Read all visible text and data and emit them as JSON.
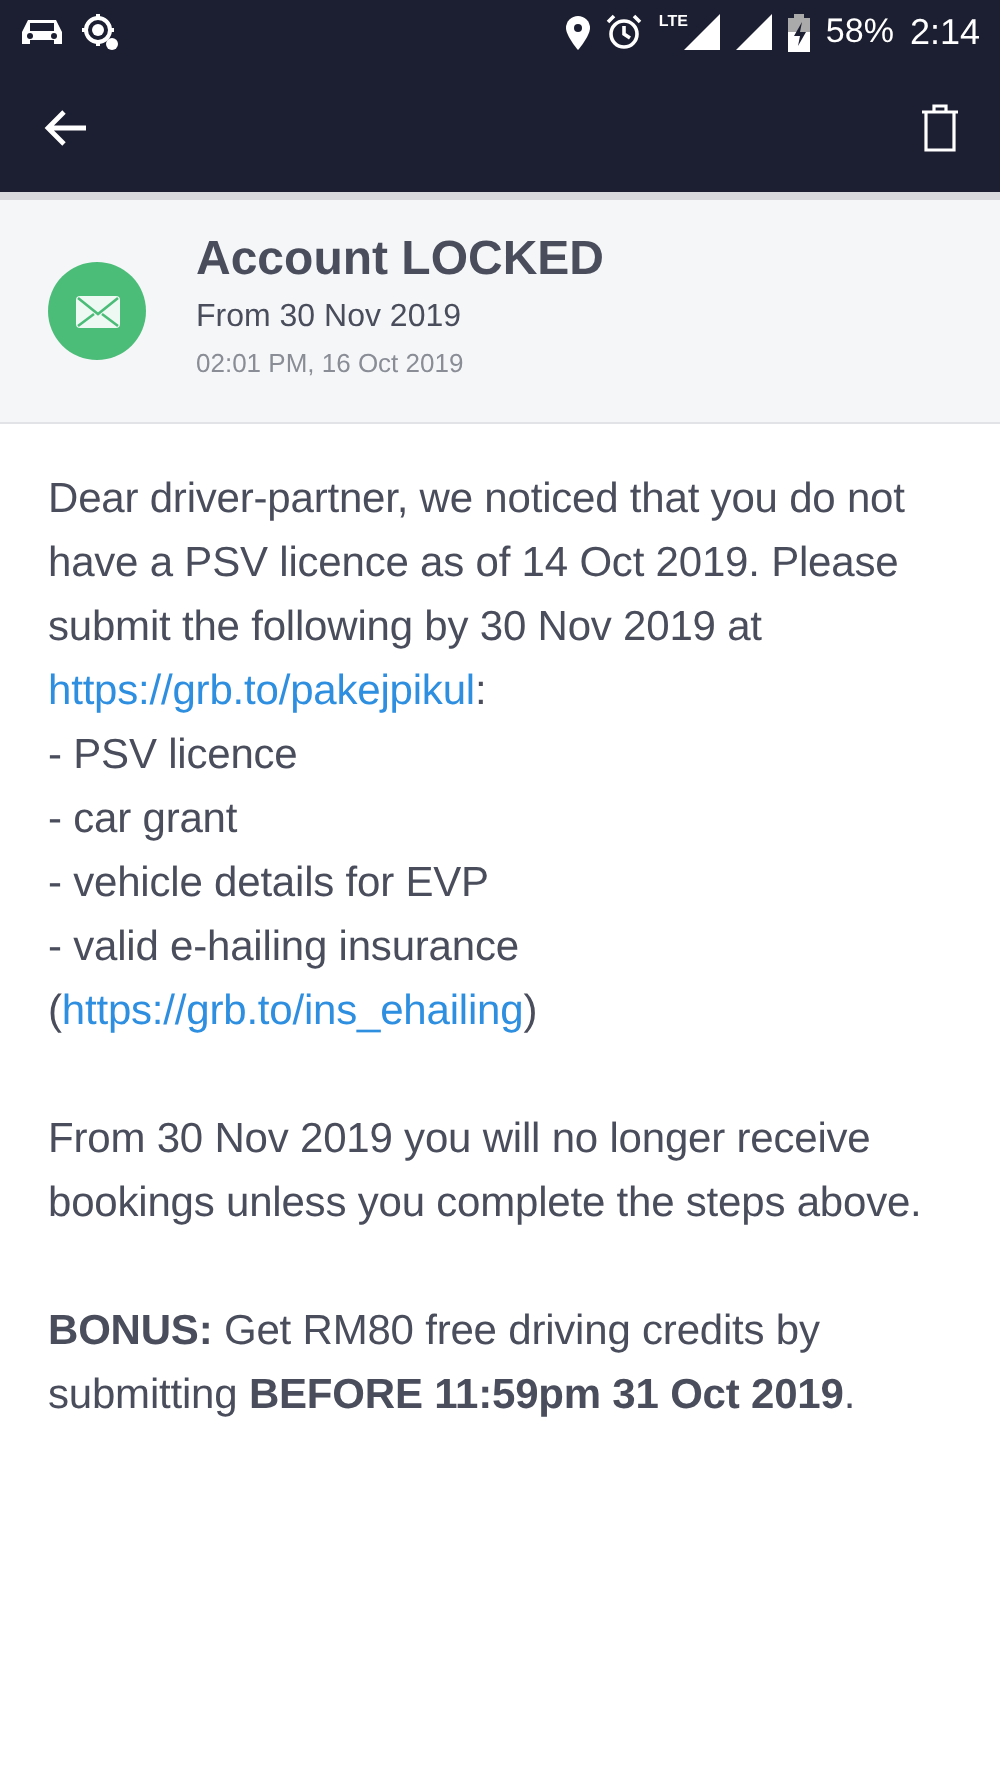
{
  "status_bar": {
    "lte_label": "LTE",
    "battery": "58%",
    "time": "2:14"
  },
  "message": {
    "title": "Account LOCKED",
    "subtitle": "From 30 Nov 2019",
    "timestamp": "02:01 PM, 16 Oct 2019"
  },
  "body": [
    {
      "kind": "sentence",
      "parts": [
        {
          "kind": "text",
          "text": "Dear driver-partner, we noticed that you do not have a PSV licence as of 14 Oct 2019. Please submit the following by 30 Nov 2019 at "
        },
        {
          "kind": "link",
          "text": "https://grb.to/pakejpikul"
        },
        {
          "kind": "text",
          "text": ":"
        }
      ]
    },
    {
      "kind": "line",
      "text": "- PSV licence"
    },
    {
      "kind": "line",
      "text": "- car grant"
    },
    {
      "kind": "line",
      "text": "- vehicle details for EVP"
    },
    {
      "kind": "line",
      "text": "- valid e-hailing insurance"
    },
    {
      "kind": "sentence",
      "parts": [
        {
          "kind": "text",
          "text": "("
        },
        {
          "kind": "link",
          "text": "https://grb.to/ins_ehailing"
        },
        {
          "kind": "text",
          "text": ")"
        }
      ]
    },
    {
      "kind": "gap"
    },
    {
      "kind": "line",
      "text": "From 30 Nov 2019 you will no longer receive bookings unless you complete the steps above."
    },
    {
      "kind": "gap"
    },
    {
      "kind": "line",
      "text": "**BONUS:** Get RM80 free driving credits by submitting **BEFORE 11:59pm 31 Oct 2019**."
    }
  ]
}
